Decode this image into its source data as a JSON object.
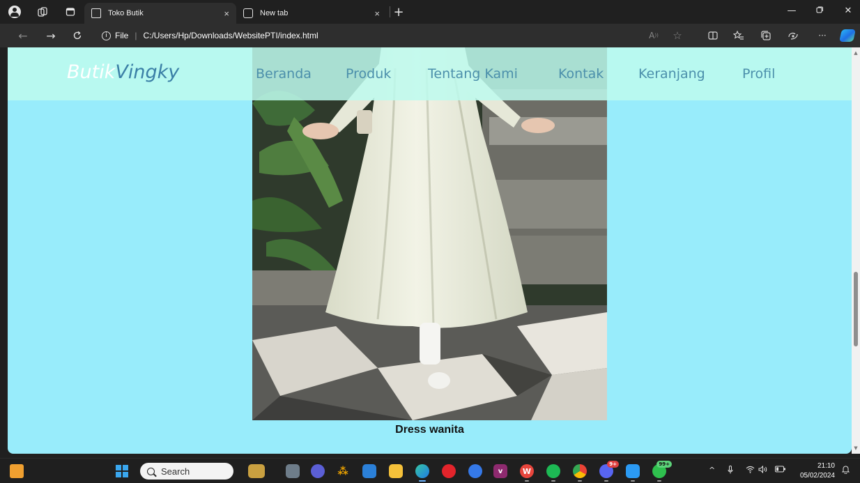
{
  "browser": {
    "tabs": [
      {
        "title": "Toko Butik",
        "active": true
      },
      {
        "title": "New tab",
        "active": false
      }
    ],
    "new_tab_symbol": "+",
    "close_symbol": "×",
    "url_scheme_label": "File",
    "url": "C:/Users/Hp/Downloads/WebsitePTI/index.html",
    "read_aloud_label": "A",
    "more_label": "···",
    "icons": [
      "profile-icon",
      "workspaces-icon",
      "tab-actions-icon",
      "back-icon",
      "forward-icon",
      "refresh-icon",
      "info-icon",
      "favorite-icon",
      "split-screen-icon",
      "favorites-bar-icon",
      "collections-icon",
      "performance-icon",
      "copilot-icon"
    ]
  },
  "site": {
    "logo_part1": "Butik",
    "logo_part2": "Vingky",
    "nav": [
      "Beranda",
      "Produk",
      "Tentang Kami",
      "Kontak",
      "Keranjang",
      "Profil"
    ],
    "product_caption": "Dress wanita",
    "colors": {
      "page_bg": "#98ecfb",
      "nav_bg": "#befaee",
      "nav_link": "#4b8fab",
      "logo_accent": "#3a7fa6"
    }
  },
  "taskbar": {
    "search_placeholder": "Search",
    "discord_badge": "9+",
    "whatsapp_badge": "99+",
    "time": "21:10",
    "date": "05/02/2024",
    "tray_chevron": "^"
  }
}
